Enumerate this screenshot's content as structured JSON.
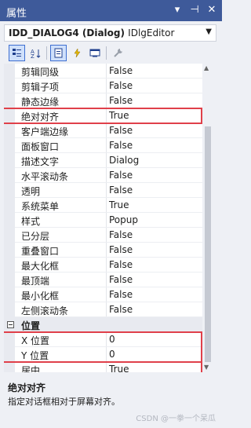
{
  "panel": {
    "title": "属性",
    "title_buttons": [
      "▾",
      "⊣",
      "✕"
    ]
  },
  "object_selector": {
    "name": "IDD_DIALOG4 (Dialog)",
    "class": "IDlgEditor"
  },
  "toolbar": {
    "icons": [
      "categorized-icon",
      "alphabetical-icon",
      "properties-icon",
      "events-icon",
      "messages-icon",
      "property-pages-icon"
    ]
  },
  "properties": [
    {
      "name": "剪辑同级",
      "value": "False"
    },
    {
      "name": "剪辑子项",
      "value": "False"
    },
    {
      "name": "静态边缘",
      "value": "False"
    },
    {
      "name": "绝对对齐",
      "value": "True"
    },
    {
      "name": "客户端边缘",
      "value": "False"
    },
    {
      "name": "面板窗口",
      "value": "False"
    },
    {
      "name": "描述文字",
      "value": "Dialog"
    },
    {
      "name": "水平滚动条",
      "value": "False"
    },
    {
      "name": "透明",
      "value": "False"
    },
    {
      "name": "系统菜单",
      "value": "True"
    },
    {
      "name": "样式",
      "value": "Popup"
    },
    {
      "name": "已分层",
      "value": "False"
    },
    {
      "name": "重叠窗口",
      "value": "False"
    },
    {
      "name": "最大化框",
      "value": "False"
    },
    {
      "name": "最顶端",
      "value": "False"
    },
    {
      "name": "最小化框",
      "value": "False"
    },
    {
      "name": "左侧滚动条",
      "value": "False"
    }
  ],
  "category": {
    "name": "位置"
  },
  "position_properties": [
    {
      "name": "X 位置",
      "value": "0"
    },
    {
      "name": "Y 位置",
      "value": "0"
    },
    {
      "name": "居中",
      "value": "True"
    }
  ],
  "description": {
    "title": "绝对对齐",
    "text": "指定对话框相对于屏幕对齐。"
  },
  "watermark": "CSDN @一拳一个呆瓜"
}
